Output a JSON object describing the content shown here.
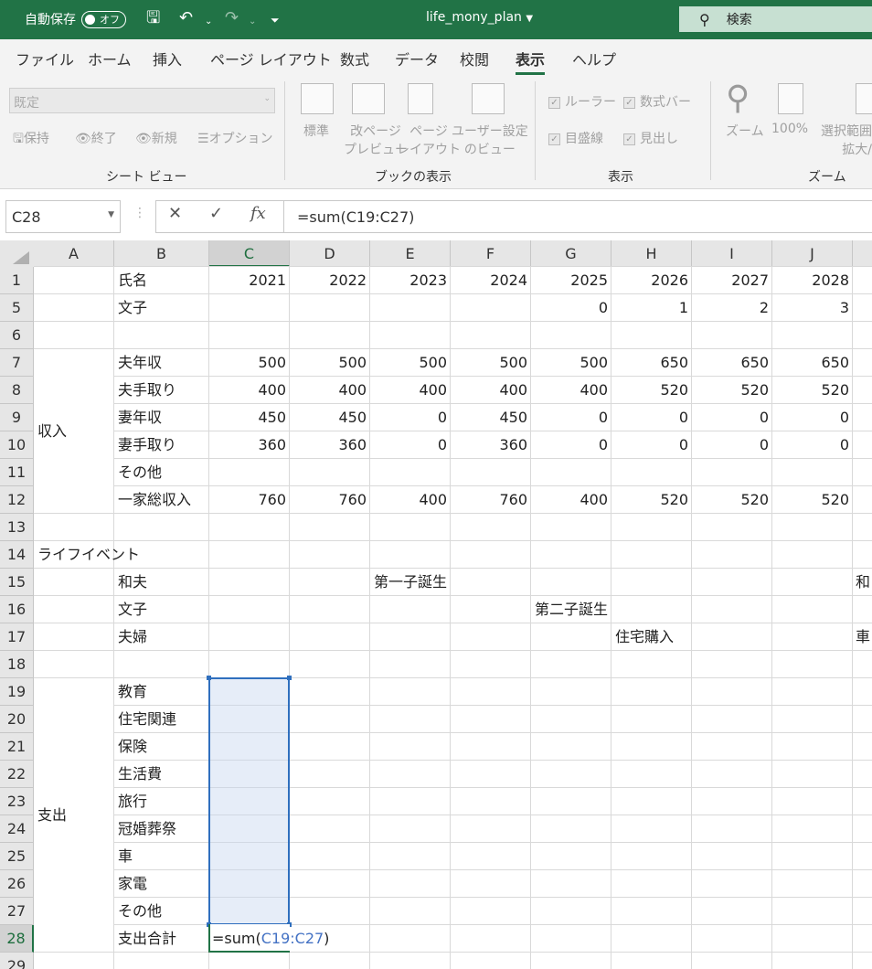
{
  "titlebar": {
    "autosave_label": "自動保存",
    "autosave_state": "オフ",
    "filename": "life_mony_plan",
    "search_placeholder": "検索",
    "accent": "#217346"
  },
  "menu": {
    "items": [
      "ファイル",
      "ホーム",
      "挿入",
      "ページ レイアウト",
      "数式",
      "データ",
      "校閲",
      "表示",
      "ヘルプ"
    ],
    "active": "表示"
  },
  "ribbon": {
    "sheet_view": {
      "dropdown": "既定",
      "keep": "保持",
      "exit": "終了",
      "new": "新規",
      "options": "オプション",
      "group": "シート ビュー"
    },
    "workbook_views": {
      "normal": "標準",
      "page_break_1": "改ページ",
      "page_break_2": "プレビュー",
      "page_layout_1": "ページ",
      "page_layout_2": "レイアウト",
      "custom_1": "ユーザー設定",
      "custom_2": "のビュー",
      "group": "ブックの表示"
    },
    "show": {
      "ruler": "ルーラー",
      "formula_bar": "数式バー",
      "gridlines": "目盛線",
      "headings": "見出し",
      "group": "表示"
    },
    "zoom": {
      "zoom": "ズーム",
      "hundred": "100%",
      "zoom_sel_1": "選択範囲",
      "zoom_sel_2": "拡大/",
      "group": "ズーム"
    }
  },
  "formula_bar": {
    "name_box": "C28",
    "cancel": "✕",
    "enter": "✓",
    "fx": "fx",
    "formula": "=sum(C19:C27)"
  },
  "sheet": {
    "columns": [
      "A",
      "B",
      "C",
      "D",
      "E",
      "F",
      "G",
      "H",
      "I",
      "J"
    ],
    "rows": [
      "1",
      "5",
      "6",
      "7",
      "8",
      "9",
      "10",
      "11",
      "12",
      "13",
      "14",
      "15",
      "16",
      "17",
      "18",
      "19",
      "20",
      "21",
      "22",
      "23",
      "24",
      "25",
      "26",
      "27",
      "28",
      "29"
    ],
    "header_row": {
      "label": "氏名",
      "years": [
        "2021",
        "2022",
        "2023",
        "2024",
        "2025",
        "2026",
        "2027",
        "2028"
      ]
    },
    "child_row": {
      "label": "文子",
      "values": [
        "0",
        "1",
        "2",
        "3"
      ]
    },
    "income_label": "収入",
    "income_rows": [
      {
        "label": "夫年収",
        "values": [
          "500",
          "500",
          "500",
          "500",
          "500",
          "650",
          "650",
          "650"
        ]
      },
      {
        "label": "夫手取り",
        "values": [
          "400",
          "400",
          "400",
          "400",
          "400",
          "520",
          "520",
          "520"
        ]
      },
      {
        "label": "妻年収",
        "values": [
          "450",
          "450",
          "0",
          "450",
          "0",
          "0",
          "0",
          "0"
        ]
      },
      {
        "label": "妻手取り",
        "values": [
          "360",
          "360",
          "0",
          "360",
          "0",
          "0",
          "0",
          "0"
        ]
      },
      {
        "label": "その他",
        "values": [
          "",
          "",
          "",
          "",
          "",
          "",
          "",
          ""
        ]
      },
      {
        "label": "一家総収入",
        "values": [
          "760",
          "760",
          "400",
          "760",
          "400",
          "520",
          "520",
          "520"
        ]
      }
    ],
    "life_event_label": "ライフイベント",
    "events": [
      {
        "label": "和夫",
        "event": "第一子誕生",
        "j_text": "和"
      },
      {
        "label": "文子",
        "event": "第二子誕生",
        "j_text": ""
      },
      {
        "label": "夫婦",
        "event": "住宅購入",
        "j_text": "車"
      }
    ],
    "expense_label": "支出",
    "expense_rows": [
      "教育",
      "住宅関連",
      "保険",
      "生活費",
      "旅行",
      "冠婚葬祭",
      "車",
      "家電",
      "その他"
    ],
    "total_label": "支出合計",
    "edit_prefix": "=sum(",
    "edit_ref": "C19:C27",
    "edit_suffix": ")",
    "range_color": "#2f6fbe"
  }
}
